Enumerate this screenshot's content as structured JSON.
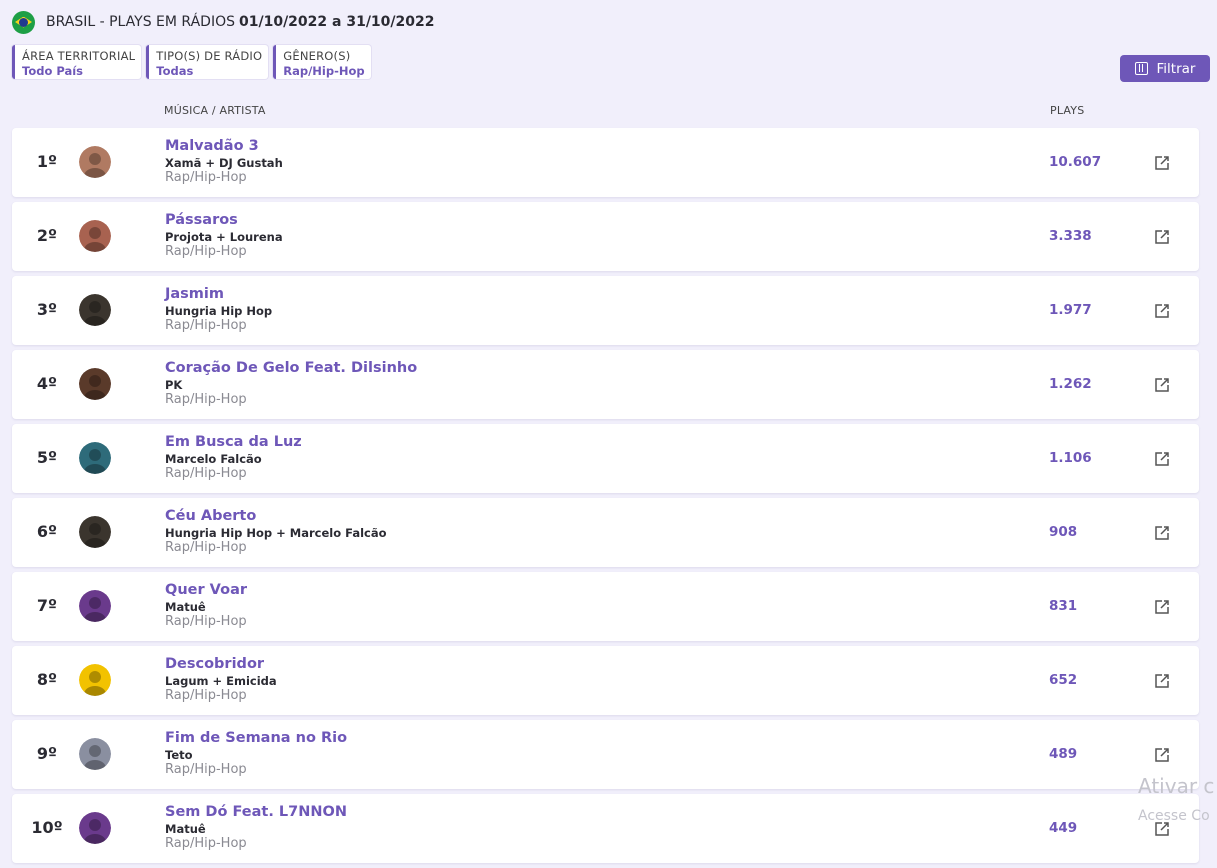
{
  "header": {
    "title": "BRASIL - PLAYS EM RÁDIOS",
    "date_range": "01/10/2022 a 31/10/2022"
  },
  "filters": [
    {
      "label": "ÁREA TERRITORIAL",
      "value": "Todo País"
    },
    {
      "label": "TIPO(S) DE RÁDIO",
      "value": "Todas"
    },
    {
      "label": "GÊNERO(S)",
      "value": "Rap/Hip-Hop"
    }
  ],
  "filter_button": {
    "label": "Filtrar",
    "icon": "sliders-icon"
  },
  "columns": {
    "music_artist": "MÚSICA / ARTISTA",
    "plays": "PLAYS"
  },
  "rows": [
    {
      "rank": "1º",
      "song": "Malvadão 3",
      "artist": "Xamã + DJ Gustah",
      "genre": "Rap/Hip-Hop",
      "plays": "10.607",
      "avatar_color": "#b07a62"
    },
    {
      "rank": "2º",
      "song": "Pássaros",
      "artist": "Projota + Lourena",
      "genre": "Rap/Hip-Hop",
      "plays": "3.338",
      "avatar_color": "#a86250"
    },
    {
      "rank": "3º",
      "song": "Jasmim",
      "artist": "Hungria Hip Hop",
      "genre": "Rap/Hip-Hop",
      "plays": "1.977",
      "avatar_color": "#3b352e"
    },
    {
      "rank": "4º",
      "song": "Coração De Gelo Feat. Dilsinho",
      "artist": "PK",
      "genre": "Rap/Hip-Hop",
      "plays": "1.262",
      "avatar_color": "#5a3a2a"
    },
    {
      "rank": "5º",
      "song": "Em Busca da Luz",
      "artist": "Marcelo Falcão",
      "genre": "Rap/Hip-Hop",
      "plays": "1.106",
      "avatar_color": "#2e6b7a"
    },
    {
      "rank": "6º",
      "song": "Céu Aberto",
      "artist": "Hungria Hip Hop + Marcelo Falcão",
      "genre": "Rap/Hip-Hop",
      "plays": "908",
      "avatar_color": "#3b352e"
    },
    {
      "rank": "7º",
      "song": "Quer Voar",
      "artist": "Matuê",
      "genre": "Rap/Hip-Hop",
      "plays": "831",
      "avatar_color": "#6a3a8c"
    },
    {
      "rank": "8º",
      "song": "Descobridor",
      "artist": "Lagum + Emicida",
      "genre": "Rap/Hip-Hop",
      "plays": "652",
      "avatar_color": "#f2c200"
    },
    {
      "rank": "9º",
      "song": "Fim de Semana no Rio",
      "artist": "Teto",
      "genre": "Rap/Hip-Hop",
      "plays": "489",
      "avatar_color": "#8a8fa0"
    },
    {
      "rank": "10º",
      "song": "Sem Dó Feat. L7NNON",
      "artist": "Matuê",
      "genre": "Rap/Hip-Hop",
      "plays": "449",
      "avatar_color": "#6a3a8c"
    }
  ],
  "row_action_icon": "external-link-icon",
  "accent_color": "#6e57b8",
  "watermark": {
    "line1": "Ativar c",
    "line2": "Acesse Co"
  }
}
